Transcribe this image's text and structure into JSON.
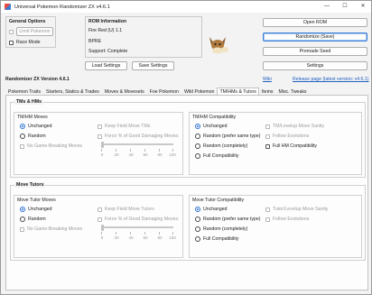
{
  "window": {
    "title": "Universal Pokemon Randomizer ZX v4.6.1",
    "controls": [
      "—",
      "☐",
      "✕"
    ]
  },
  "general_options": {
    "legend": "General Options",
    "limit_pokemon": "Limit Pokemon",
    "race_mode": "Race Mode"
  },
  "rom_info": {
    "legend": "ROM Information",
    "name": "Fire Red (U) 1.1",
    "code": "BPRE",
    "support": "Support: Complete"
  },
  "buttons": {
    "open_rom": "Open ROM",
    "randomize_save": "Randomize (Save)",
    "premade_seed": "Premade Seed",
    "settings": "Settings",
    "load_settings": "Load Settings",
    "save_settings": "Save Settings"
  },
  "version_label": "Randomizer ZX Version 4.6.1",
  "links": {
    "wiki": "Wiki",
    "release_page": "Release page (latest version: v4.6.1)"
  },
  "tabs": [
    "Pokemon Traits",
    "Starters, Statics & Trades",
    "Moves & Movesets",
    "Foe Pokemon",
    "Wild Pokemon",
    "TM/HMs & Tutors",
    "Items",
    "Misc. Tweaks"
  ],
  "active_tab": "TM/HMs & Tutors",
  "tms_hms": {
    "legend": "TMs & HMs",
    "moves": {
      "legend": "TM/HM Moves",
      "unchanged": "Unchanged",
      "random": "Random",
      "no_game_breaking": "No Game-Breaking Moves",
      "keep_field": "Keep Field Move TMs",
      "force_good": "Force % of Good Damaging Moves:",
      "slider_value": 0,
      "slider_ticks": [
        "0",
        "20",
        "40",
        "60",
        "80",
        "100"
      ]
    },
    "compat": {
      "legend": "TM/HM Compatibility",
      "unchanged": "Unchanged",
      "random_prefer": "Random (prefer same type)",
      "random_completely": "Random (completely)",
      "full": "Full Compatibility",
      "levelup_sanity": "TM/Levelup Move Sanity",
      "follow_evolutions": "Follow Evolutions",
      "full_hm": "Full HM Compatibility"
    }
  },
  "move_tutors": {
    "legend": "Move Tutors",
    "moves": {
      "legend": "Move Tutor Moves",
      "unchanged": "Unchanged",
      "random": "Random",
      "no_game_breaking": "No Game-Breaking Moves",
      "keep_field": "Keep Field Move Tutors",
      "force_good": "Force % of Good Damaging Moves:",
      "slider_value": 0,
      "slider_ticks": [
        "0",
        "20",
        "40",
        "60",
        "80",
        "100"
      ]
    },
    "compat": {
      "legend": "Move Tutor Compatibility",
      "unchanged": "Unchanged",
      "random_prefer": "Random (prefer same type)",
      "random_completely": "Random (completely)",
      "full": "Full Compatibility",
      "levelup_sanity": "Tutor/Levelup Move Sanity",
      "follow_evolutions": "Follow Evolutions"
    }
  },
  "colors": {
    "accent": "#2a6fcf",
    "link": "#1f5fbf",
    "disabled": "#9b9b9b"
  },
  "icons": {
    "mascot": "eevee-icon"
  }
}
